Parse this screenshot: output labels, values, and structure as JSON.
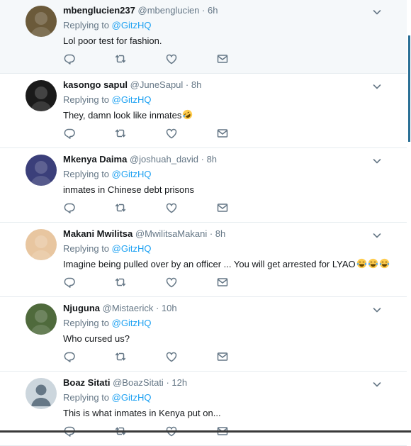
{
  "replies": [
    {
      "name": "mbenglucien237",
      "handle": "@mbenglucien",
      "time": "6h",
      "replying_to_label": "Replying to",
      "replying_to": "@GitzHQ",
      "text": "Lol poor test for fashion.",
      "emojis": [],
      "highlighted": true,
      "avatar_color": "#6b5a3a"
    },
    {
      "name": "kasongo sapul",
      "handle": "@JuneSapul",
      "time": "8h",
      "replying_to_label": "Replying to",
      "replying_to": "@GitzHQ",
      "text": "They, damn look like inmates",
      "emojis": [
        "rolling-laughing"
      ],
      "highlighted": false,
      "avatar_color": "#1a1a1a"
    },
    {
      "name": "Mkenya Daima",
      "handle": "@joshuah_david",
      "time": "8h",
      "replying_to_label": "Replying to",
      "replying_to": "@GitzHQ",
      "text": "inmates in Chinese debt prisons",
      "emojis": [],
      "highlighted": false,
      "avatar_color": "#3b3f7a"
    },
    {
      "name": "Makani Mwilitsa",
      "handle": "@MwilitsaMakani",
      "time": "8h",
      "replying_to_label": "Replying to",
      "replying_to": "@GitzHQ",
      "text": "Imagine being pulled over by an officer ... You will get arrested for LYAO",
      "emojis": [
        "joy",
        "joy",
        "joy"
      ],
      "highlighted": false,
      "avatar_color": "#e8c6a0"
    },
    {
      "name": "Njuguna",
      "handle": "@Mistaerick",
      "time": "10h",
      "replying_to_label": "Replying to",
      "replying_to": "@GitzHQ",
      "text": "Who cursed us?",
      "emojis": [],
      "highlighted": false,
      "avatar_color": "#4f6a3c"
    },
    {
      "name": "Boaz Sitati",
      "handle": "@BoazSitati",
      "time": "12h",
      "replying_to_label": "Replying to",
      "replying_to": "@GitzHQ",
      "text": "This is what inmates in Kenya put on...",
      "emojis": [],
      "highlighted": false,
      "avatar_color": "#ccd6dd"
    }
  ],
  "colors": {
    "accent": "#1da1f2",
    "muted": "#657786",
    "text": "#14171a",
    "divider": "#e6ecf0",
    "icon": "#657786"
  },
  "icons": [
    "reply-icon",
    "retweet-icon",
    "like-icon",
    "direct-message-icon",
    "chevron-down-icon"
  ]
}
